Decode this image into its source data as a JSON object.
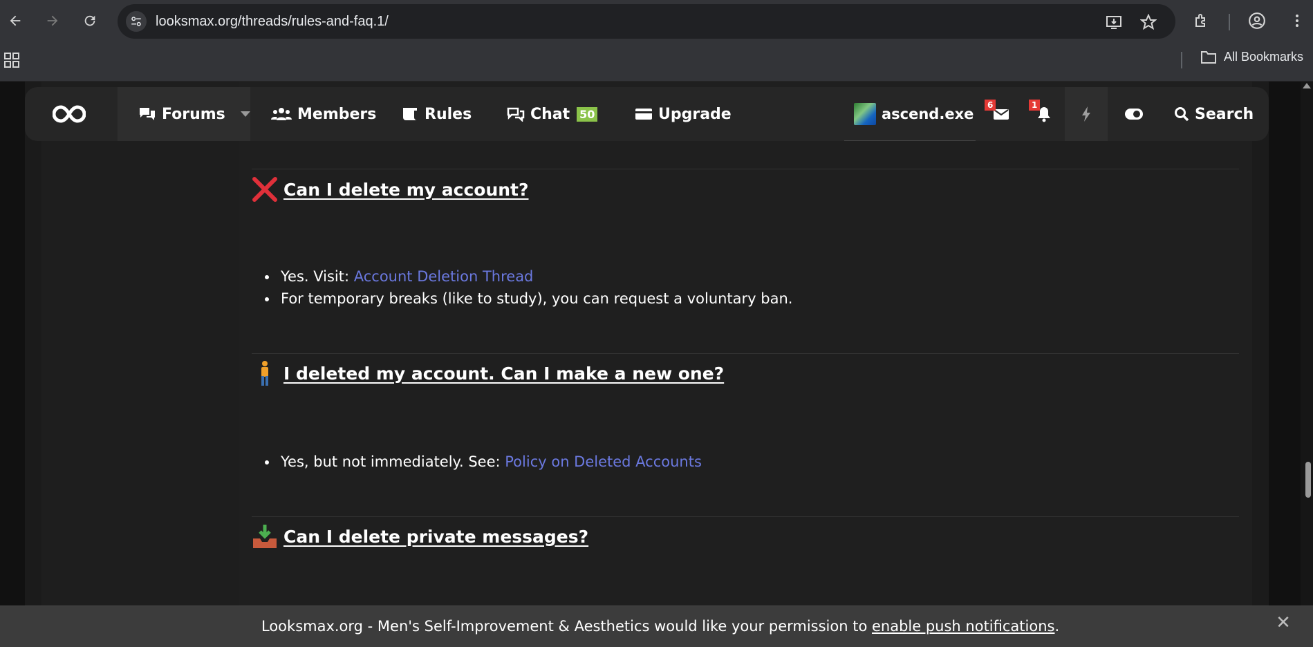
{
  "browser": {
    "url": "looksmax.org/threads/rules-and-faq.1/",
    "bookmarks_label": "All Bookmarks"
  },
  "site_nav": {
    "items": [
      {
        "label": "Forums"
      },
      {
        "label": "Members"
      },
      {
        "label": "Rules"
      },
      {
        "label": "Chat"
      },
      {
        "label": "Upgrade"
      }
    ],
    "chat_count": "50",
    "username": "ascend.exe",
    "messages_badge": "6",
    "alerts_badge": "1",
    "search_label": "Search"
  },
  "faq": [
    {
      "question": "Can I delete my account?",
      "icon": "red-cross-icon",
      "items": [
        {
          "text": "Yes. Visit: ",
          "link": "Account Deletion Thread"
        },
        {
          "text": "For temporary breaks (like to study), you can request a voluntary ban.",
          "link": ""
        }
      ]
    },
    {
      "question": "I deleted my account. Can I make a new one?",
      "icon": "person-standing-icon",
      "items": [
        {
          "text": "Yes, but not immediately. See: ",
          "link": "Policy on Deleted Accounts"
        }
      ]
    },
    {
      "question": "Can I delete private messages?",
      "icon": "inbox-tray-icon",
      "items": []
    }
  ],
  "notification": {
    "text": "Looksmax.org - Men's Self-Improvement & Aesthetics would like your permission to ",
    "link": "enable push notifications",
    "suffix": "."
  },
  "colors": {
    "link": "#6b79e0",
    "badge": "#e53935",
    "chat_badge": "#8bc34a"
  }
}
